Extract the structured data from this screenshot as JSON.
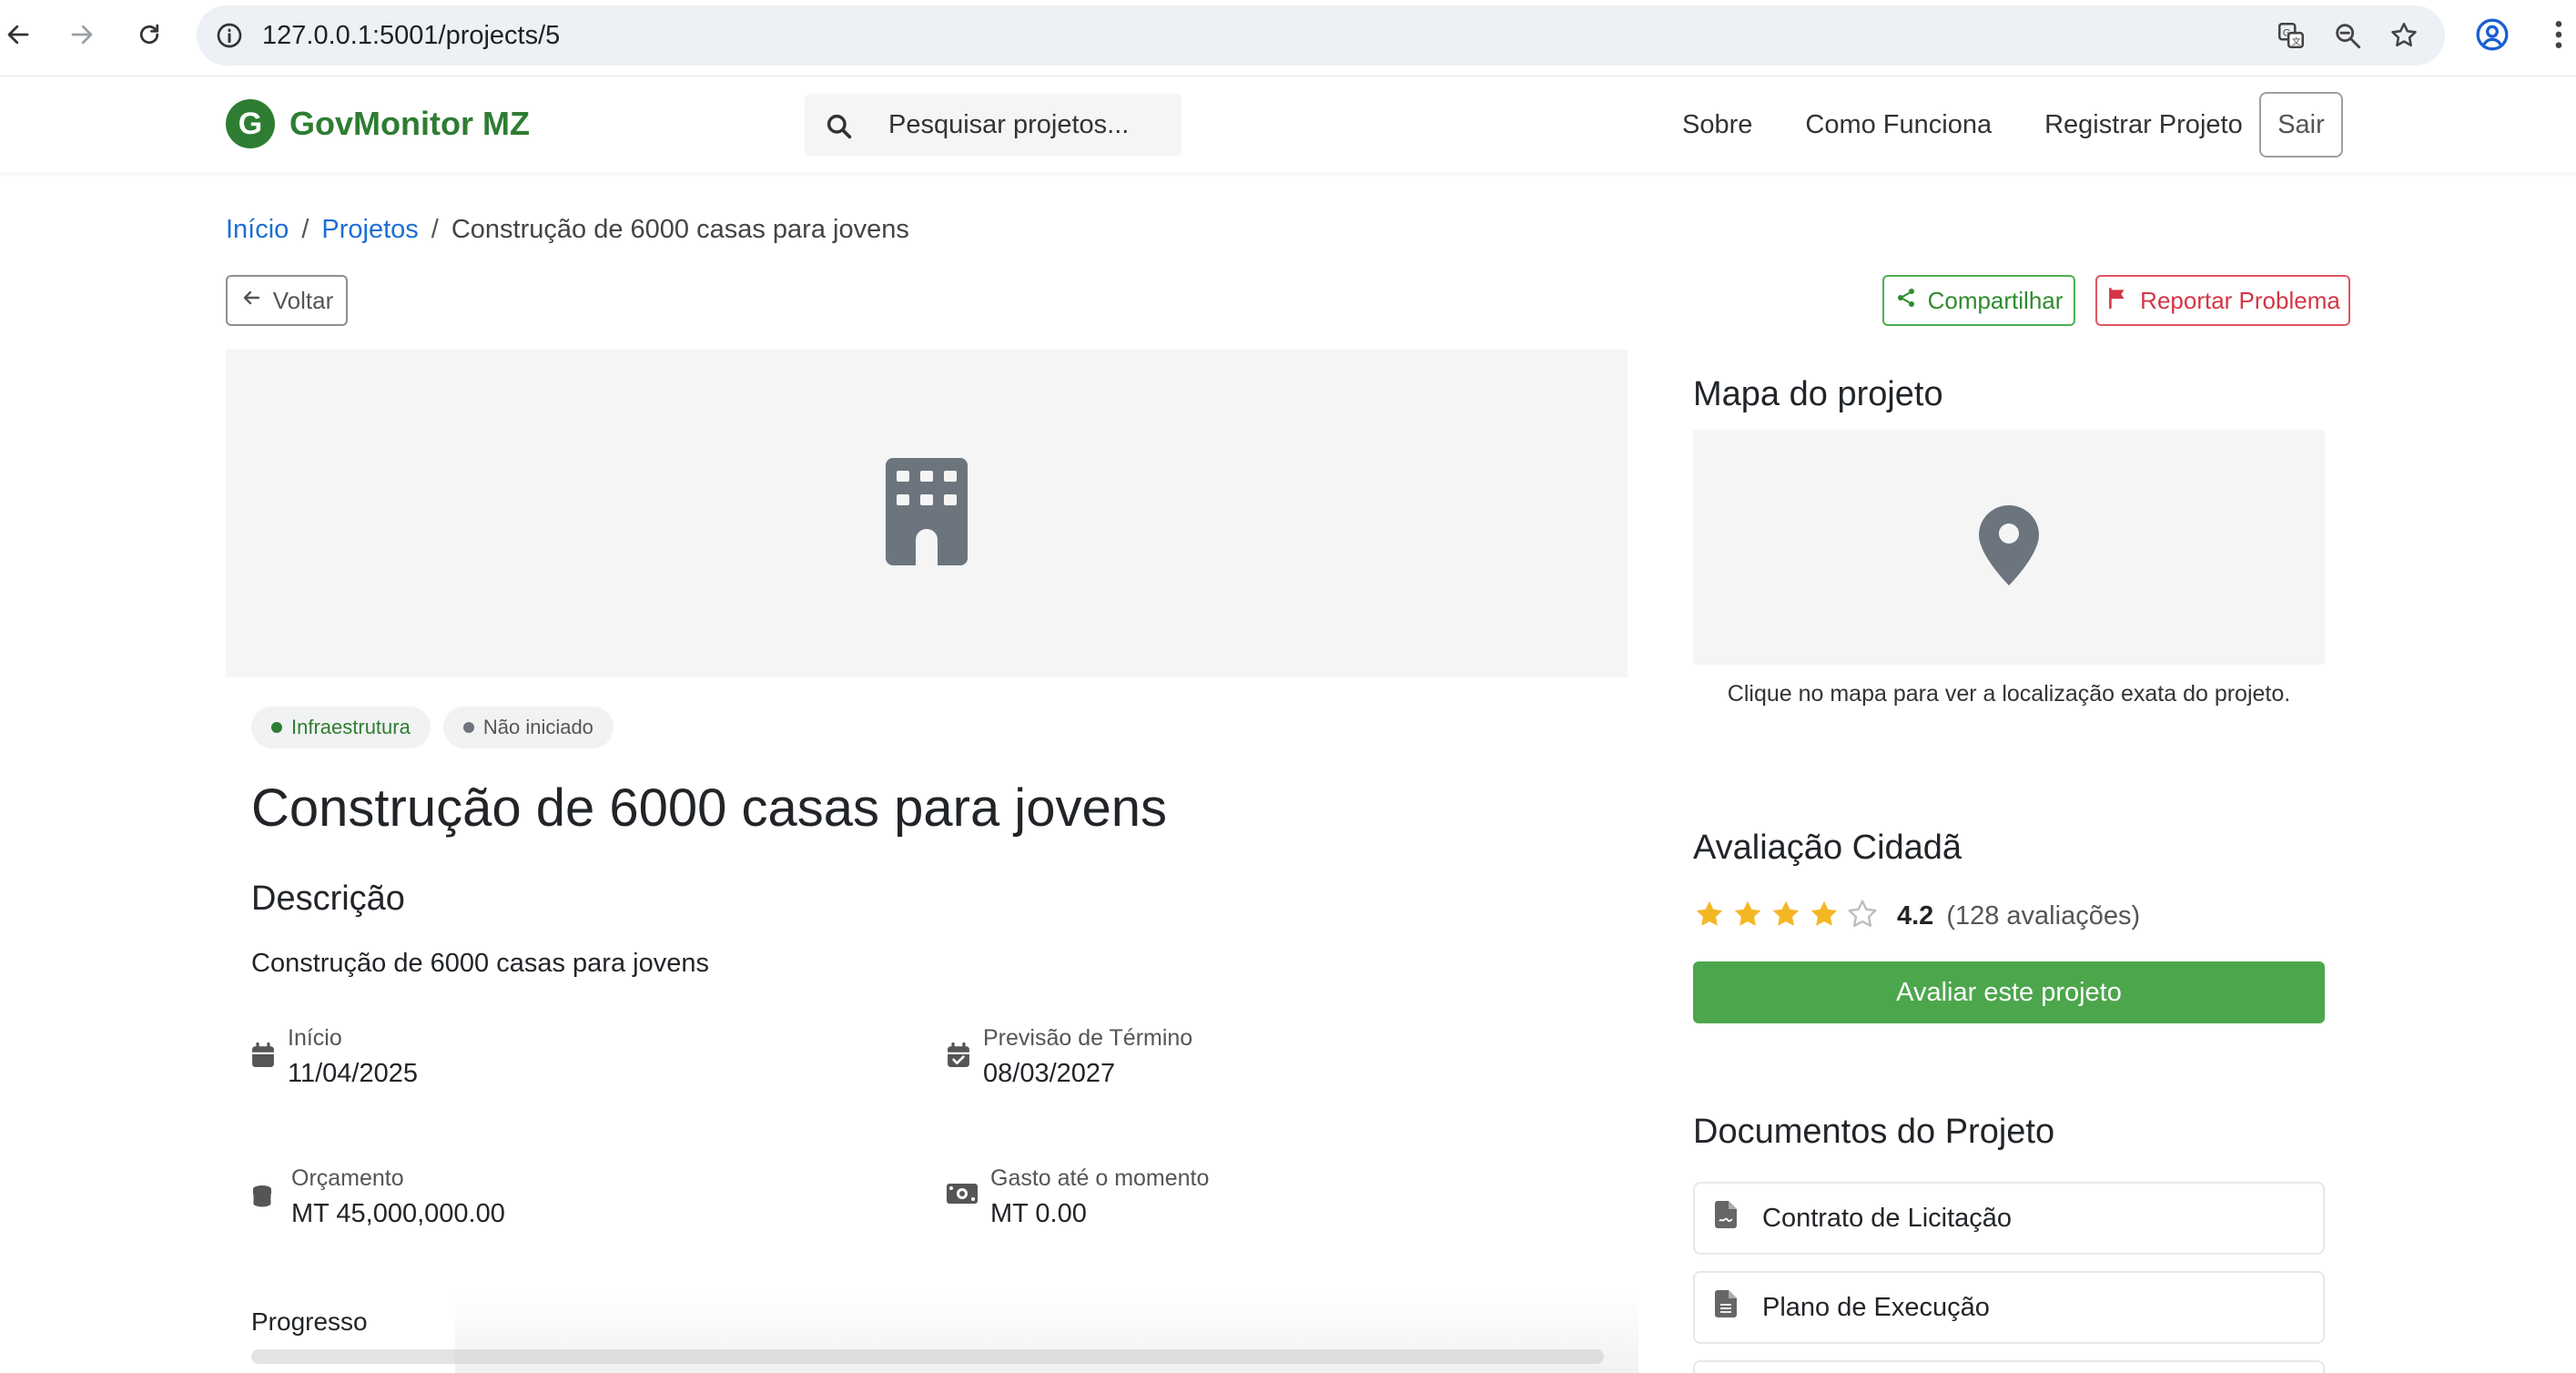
{
  "browser": {
    "url": "127.0.0.1:5001/projects/5",
    "icons": [
      "back-arrow-icon",
      "forward-arrow-icon",
      "reload-icon",
      "site-info-icon",
      "translate-icon",
      "zoom-icon",
      "bookmark-star-icon",
      "profile-icon",
      "menu-dots-icon"
    ]
  },
  "header": {
    "logo_letter": "G",
    "brand": "GovMonitor MZ",
    "search_placeholder": "Pesquisar projetos...",
    "nav": [
      "Sobre",
      "Como Funciona",
      "Registrar Projeto"
    ],
    "logout": "Sair"
  },
  "breadcrumb": {
    "home": "Início",
    "projects": "Projetos",
    "current": "Construção de 6000 casas para jovens",
    "separator": "/"
  },
  "actions": {
    "back": "Voltar",
    "share": "Compartilhar",
    "report": "Reportar Problema"
  },
  "project": {
    "tags": {
      "category": "Infraestrutura",
      "status": "Não iniciado"
    },
    "title": "Construção de 6000 casas para jovens",
    "description_heading": "Descrição",
    "description": "Construção de 6000 casas para jovens",
    "start": {
      "label": "Início",
      "value": "11/04/2025"
    },
    "end": {
      "label": "Previsão de Término",
      "value": "08/03/2027"
    },
    "budget": {
      "label": "Orçamento",
      "value": "MT 45,000,000.00"
    },
    "spent": {
      "label": "Gasto até o momento",
      "value": "MT 0.00"
    },
    "progress_label": "Progresso",
    "progress_fraction": 0
  },
  "sidebar": {
    "map_title": "Mapa do projeto",
    "map_hint": "Clique no mapa para ver a localização exata do projeto.",
    "rating_title": "Avaliação Cidadã",
    "rating_score": "4.2",
    "rating_stars_filled": 4,
    "rating_count": "(128 avaliações)",
    "rate_button": "Avaliar este projeto",
    "documents_title": "Documentos do Projeto",
    "documents": [
      "Contrato de Licitação",
      "Plano de Execução"
    ]
  },
  "colors": {
    "brand_green": "#2e7d32",
    "button_green": "#4ca64c",
    "link_blue": "#1a6fd6",
    "report_red": "#d33545",
    "star_gold": "#f4b724"
  }
}
